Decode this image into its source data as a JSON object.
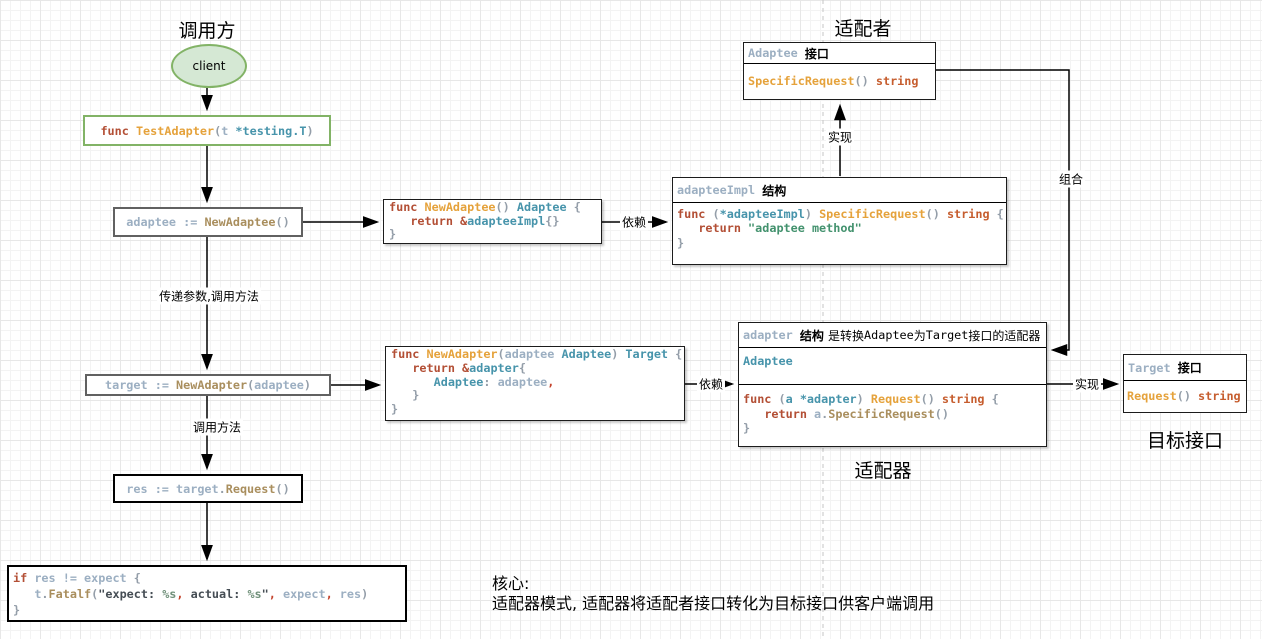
{
  "titles": {
    "caller": "调用方",
    "adaptee_side": "适配者",
    "adapter_caption": "适配器",
    "target_caption": "目标接口"
  },
  "client_label": "client",
  "labels": {
    "depend1": "依赖",
    "realize1": "实现",
    "compose": "组合",
    "pass_call": "传递参数,调用方法",
    "call_method": "调用方法",
    "depend2": "依赖",
    "realize2": "实现"
  },
  "note": {
    "heading": "核心:",
    "body": "适配器模式, 适配器将适配者接口转化为目标接口供客户端调用"
  },
  "code": {
    "test_adapter": [
      [
        [
          "kw",
          "func "
        ],
        [
          "fn",
          "TestAdapter"
        ],
        [
          "pu",
          "("
        ],
        [
          "id",
          "t "
        ],
        [
          "ty",
          "*testing.T"
        ],
        [
          "pu",
          ")"
        ]
      ]
    ],
    "adaptee_stmt": [
      [
        [
          "id",
          "adaptee := "
        ],
        [
          "ca",
          "NewAdaptee"
        ],
        [
          "pu",
          "()"
        ]
      ]
    ],
    "new_adaptee": [
      [
        [
          "kw",
          "func "
        ],
        [
          "fn",
          "NewAdaptee"
        ],
        [
          "pu",
          "() "
        ],
        [
          "ty",
          "Adaptee "
        ],
        [
          "pu",
          "{"
        ]
      ],
      [
        [
          "pu",
          "   "
        ],
        [
          "kw",
          "return &"
        ],
        [
          "ty",
          "adapteeImpl"
        ],
        [
          "pu",
          "{}"
        ]
      ],
      [
        [
          "pu",
          "}"
        ]
      ]
    ],
    "adaptee_impl_header": [
      [
        [
          "id",
          "adapteeImpl "
        ],
        [
          "hb",
          "结构"
        ]
      ]
    ],
    "adaptee_impl_body": [
      [
        [
          "kw",
          "func "
        ],
        [
          "pu",
          "("
        ],
        [
          "ty",
          "*adapteeImpl"
        ],
        [
          "pu",
          ") "
        ],
        [
          "fn",
          "SpecificRequest"
        ],
        [
          "pu",
          "() "
        ],
        [
          "st2",
          "string "
        ],
        [
          "pu",
          "{"
        ]
      ],
      [
        [
          "pu",
          "   "
        ],
        [
          "kw",
          "return "
        ],
        [
          "st",
          "\"adaptee method\""
        ]
      ],
      [
        [
          "pu",
          "}"
        ]
      ]
    ],
    "adaptee_iface_header": [
      [
        [
          "id",
          "Adaptee "
        ],
        [
          "hb",
          "接口"
        ]
      ]
    ],
    "adaptee_iface_body": [
      [
        [
          "fn",
          "SpecificRequest"
        ],
        [
          "pu",
          "() "
        ],
        [
          "st2",
          "string"
        ]
      ]
    ],
    "target_stmt": [
      [
        [
          "id",
          "target := "
        ],
        [
          "ca",
          "NewAdapter"
        ],
        [
          "pu",
          "("
        ],
        [
          "id",
          "adaptee"
        ],
        [
          "pu",
          ")"
        ]
      ]
    ],
    "new_adapter": [
      [
        [
          "kw",
          "func "
        ],
        [
          "fn",
          "NewAdapter"
        ],
        [
          "pu",
          "("
        ],
        [
          "id",
          "adaptee "
        ],
        [
          "ty",
          "Adaptee"
        ],
        [
          "pu",
          ") "
        ],
        [
          "ty",
          "Target "
        ],
        [
          "pu",
          "{"
        ]
      ],
      [
        [
          "pu",
          "   "
        ],
        [
          "kw",
          "return &"
        ],
        [
          "ty",
          "adapter"
        ],
        [
          "pu",
          "{"
        ]
      ],
      [
        [
          "pu",
          "      "
        ],
        [
          "ty",
          "Adaptee"
        ],
        [
          "pu",
          ": "
        ],
        [
          "id",
          "adaptee"
        ],
        [
          "cm",
          ","
        ]
      ],
      [
        [
          "pu",
          "   }"
        ]
      ],
      [
        [
          "pu",
          "}"
        ]
      ]
    ],
    "adapter_header": [
      [
        [
          "id",
          "adapter "
        ],
        [
          "hb",
          "结构 "
        ],
        [
          "zh",
          "是转换"
        ],
        [
          "mb",
          "Adaptee"
        ],
        [
          "zh",
          "为"
        ],
        [
          "mb",
          "Target"
        ],
        [
          "zh",
          "接口的适配器"
        ]
      ]
    ],
    "adapter_field": [
      [
        [
          "ty",
          "Adaptee"
        ]
      ]
    ],
    "adapter_body": [
      [
        [
          "kw",
          "func "
        ],
        [
          "pu",
          "("
        ],
        [
          "ty",
          "a *adapter"
        ],
        [
          "pu",
          ") "
        ],
        [
          "fn",
          "Request"
        ],
        [
          "pu",
          "() "
        ],
        [
          "st2",
          "string "
        ],
        [
          "pu",
          "{"
        ]
      ],
      [
        [
          "pu",
          "   "
        ],
        [
          "kw",
          "return "
        ],
        [
          "id",
          "a"
        ],
        [
          "pu",
          "."
        ],
        [
          "ca",
          "SpecificRequest"
        ],
        [
          "pu",
          "()"
        ]
      ],
      [
        [
          "pu",
          "}"
        ]
      ]
    ],
    "target_iface_header": [
      [
        [
          "id",
          "Target "
        ],
        [
          "hb",
          "接口"
        ]
      ]
    ],
    "target_iface_body": [
      [
        [
          "fn",
          "Request"
        ],
        [
          "pu",
          "() "
        ],
        [
          "st2",
          "string"
        ]
      ]
    ],
    "res_stmt": [
      [
        [
          "id",
          "res := target"
        ],
        [
          "pu",
          "."
        ],
        [
          "ca",
          "Request"
        ],
        [
          "pu",
          "()"
        ]
      ]
    ],
    "if_block": [
      [
        [
          "kw",
          "if "
        ],
        [
          "id",
          "res != expect "
        ],
        [
          "pu",
          "{"
        ]
      ],
      [
        [
          "pu",
          "   "
        ],
        [
          "id",
          "t"
        ],
        [
          "pu",
          "."
        ],
        [
          "ca",
          "Fatalf"
        ],
        [
          "pu",
          "("
        ],
        [
          "sd",
          "\"expect: "
        ],
        [
          "sv",
          "%s"
        ],
        [
          "cm",
          ","
        ],
        [
          "sd",
          " actual: "
        ],
        [
          "sv",
          "%s"
        ],
        [
          "sd",
          "\""
        ],
        [
          "cm",
          ","
        ],
        [
          "id",
          " expect"
        ],
        [
          "cm",
          ","
        ],
        [
          "id",
          " res"
        ],
        [
          "pu",
          ")"
        ]
      ],
      [
        [
          "pu",
          "}"
        ]
      ]
    ]
  }
}
